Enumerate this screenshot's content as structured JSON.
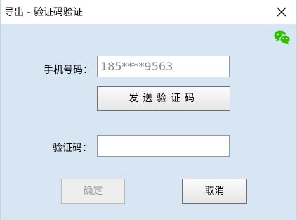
{
  "window": {
    "title": "导出 - 验证码验证"
  },
  "icons": {
    "close": "close-icon",
    "wechat": "wechat-icon"
  },
  "form": {
    "phone_label": "手机号码：",
    "phone_value": "185****9563",
    "send_code_label": "发送验证码",
    "code_label": "验证码：",
    "code_value": ""
  },
  "buttons": {
    "confirm_label": "确定",
    "cancel_label": "取消"
  },
  "colors": {
    "dialog_bg": "#d8e5f3",
    "wechat_green": "#2dc100"
  }
}
